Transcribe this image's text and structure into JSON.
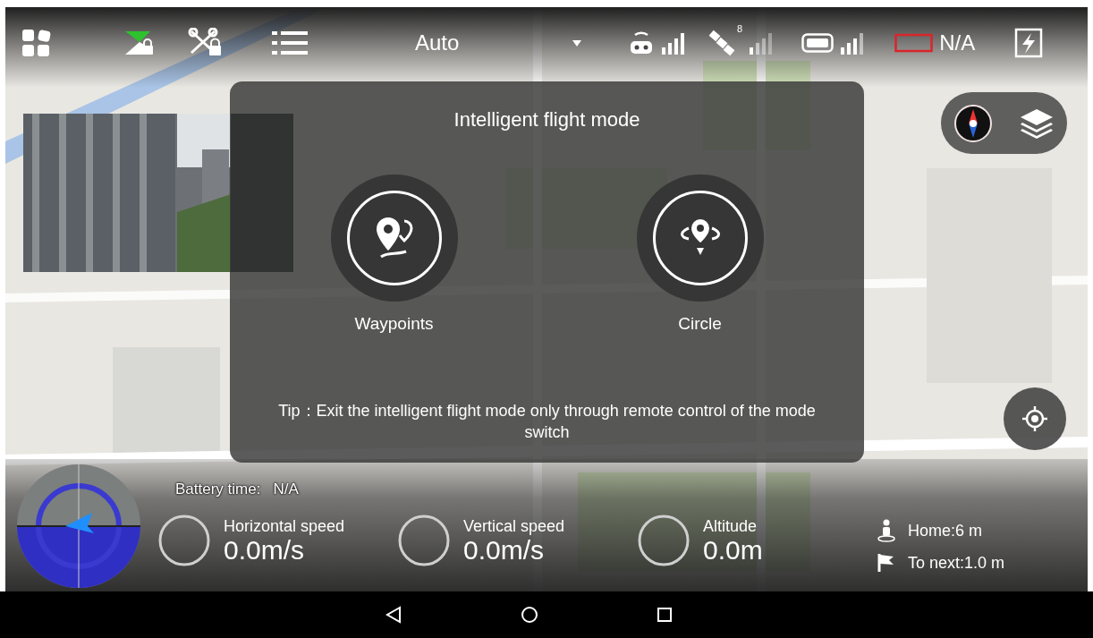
{
  "top_bar": {
    "flight_mode": "Auto",
    "satellites": "8",
    "battery": "N/A"
  },
  "dialog": {
    "title": "Intelligent flight mode",
    "modes": [
      {
        "kind": "waypoints",
        "label": "Waypoints"
      },
      {
        "kind": "circle",
        "label": "Circle"
      }
    ],
    "tip": "Tip：Exit the intelligent flight mode only through remote control of the mode switch"
  },
  "battery_time": {
    "label": "Battery time:",
    "value": "N/A"
  },
  "telemetry": [
    {
      "label": "Horizontal speed",
      "value": "0.0m/s"
    },
    {
      "label": "Vertical speed",
      "value": "0.0m/s"
    },
    {
      "label": "Altitude",
      "value": "0.0m"
    }
  ],
  "distances": [
    {
      "kind": "home",
      "text": "Home:6 m"
    },
    {
      "kind": "next",
      "text": "To next:1.0 m"
    }
  ]
}
